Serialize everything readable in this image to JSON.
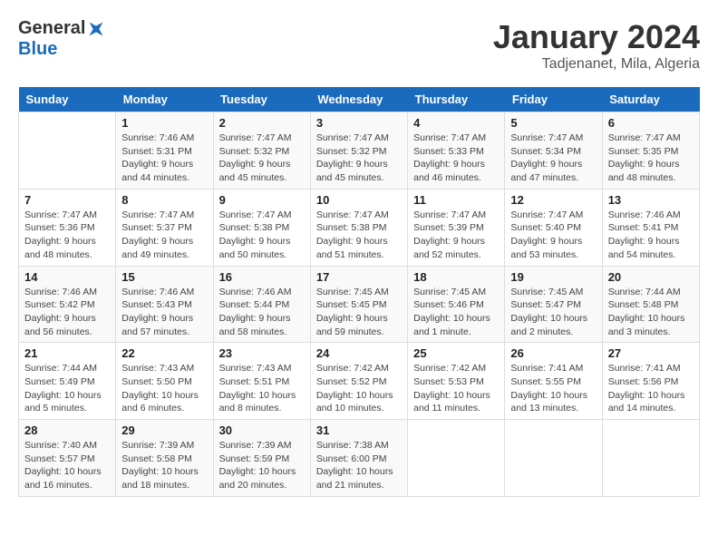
{
  "header": {
    "logo_general": "General",
    "logo_blue": "Blue",
    "month_title": "January 2024",
    "subtitle": "Tadjenanet, Mila, Algeria"
  },
  "days_of_week": [
    "Sunday",
    "Monday",
    "Tuesday",
    "Wednesday",
    "Thursday",
    "Friday",
    "Saturday"
  ],
  "weeks": [
    [
      {
        "day": "",
        "sunrise": "",
        "sunset": "",
        "daylight": ""
      },
      {
        "day": "1",
        "sunrise": "Sunrise: 7:46 AM",
        "sunset": "Sunset: 5:31 PM",
        "daylight": "Daylight: 9 hours and 44 minutes."
      },
      {
        "day": "2",
        "sunrise": "Sunrise: 7:47 AM",
        "sunset": "Sunset: 5:32 PM",
        "daylight": "Daylight: 9 hours and 45 minutes."
      },
      {
        "day": "3",
        "sunrise": "Sunrise: 7:47 AM",
        "sunset": "Sunset: 5:32 PM",
        "daylight": "Daylight: 9 hours and 45 minutes."
      },
      {
        "day": "4",
        "sunrise": "Sunrise: 7:47 AM",
        "sunset": "Sunset: 5:33 PM",
        "daylight": "Daylight: 9 hours and 46 minutes."
      },
      {
        "day": "5",
        "sunrise": "Sunrise: 7:47 AM",
        "sunset": "Sunset: 5:34 PM",
        "daylight": "Daylight: 9 hours and 47 minutes."
      },
      {
        "day": "6",
        "sunrise": "Sunrise: 7:47 AM",
        "sunset": "Sunset: 5:35 PM",
        "daylight": "Daylight: 9 hours and 48 minutes."
      }
    ],
    [
      {
        "day": "7",
        "sunrise": "Sunrise: 7:47 AM",
        "sunset": "Sunset: 5:36 PM",
        "daylight": "Daylight: 9 hours and 48 minutes."
      },
      {
        "day": "8",
        "sunrise": "Sunrise: 7:47 AM",
        "sunset": "Sunset: 5:37 PM",
        "daylight": "Daylight: 9 hours and 49 minutes."
      },
      {
        "day": "9",
        "sunrise": "Sunrise: 7:47 AM",
        "sunset": "Sunset: 5:38 PM",
        "daylight": "Daylight: 9 hours and 50 minutes."
      },
      {
        "day": "10",
        "sunrise": "Sunrise: 7:47 AM",
        "sunset": "Sunset: 5:38 PM",
        "daylight": "Daylight: 9 hours and 51 minutes."
      },
      {
        "day": "11",
        "sunrise": "Sunrise: 7:47 AM",
        "sunset": "Sunset: 5:39 PM",
        "daylight": "Daylight: 9 hours and 52 minutes."
      },
      {
        "day": "12",
        "sunrise": "Sunrise: 7:47 AM",
        "sunset": "Sunset: 5:40 PM",
        "daylight": "Daylight: 9 hours and 53 minutes."
      },
      {
        "day": "13",
        "sunrise": "Sunrise: 7:46 AM",
        "sunset": "Sunset: 5:41 PM",
        "daylight": "Daylight: 9 hours and 54 minutes."
      }
    ],
    [
      {
        "day": "14",
        "sunrise": "Sunrise: 7:46 AM",
        "sunset": "Sunset: 5:42 PM",
        "daylight": "Daylight: 9 hours and 56 minutes."
      },
      {
        "day": "15",
        "sunrise": "Sunrise: 7:46 AM",
        "sunset": "Sunset: 5:43 PM",
        "daylight": "Daylight: 9 hours and 57 minutes."
      },
      {
        "day": "16",
        "sunrise": "Sunrise: 7:46 AM",
        "sunset": "Sunset: 5:44 PM",
        "daylight": "Daylight: 9 hours and 58 minutes."
      },
      {
        "day": "17",
        "sunrise": "Sunrise: 7:45 AM",
        "sunset": "Sunset: 5:45 PM",
        "daylight": "Daylight: 9 hours and 59 minutes."
      },
      {
        "day": "18",
        "sunrise": "Sunrise: 7:45 AM",
        "sunset": "Sunset: 5:46 PM",
        "daylight": "Daylight: 10 hours and 1 minute."
      },
      {
        "day": "19",
        "sunrise": "Sunrise: 7:45 AM",
        "sunset": "Sunset: 5:47 PM",
        "daylight": "Daylight: 10 hours and 2 minutes."
      },
      {
        "day": "20",
        "sunrise": "Sunrise: 7:44 AM",
        "sunset": "Sunset: 5:48 PM",
        "daylight": "Daylight: 10 hours and 3 minutes."
      }
    ],
    [
      {
        "day": "21",
        "sunrise": "Sunrise: 7:44 AM",
        "sunset": "Sunset: 5:49 PM",
        "daylight": "Daylight: 10 hours and 5 minutes."
      },
      {
        "day": "22",
        "sunrise": "Sunrise: 7:43 AM",
        "sunset": "Sunset: 5:50 PM",
        "daylight": "Daylight: 10 hours and 6 minutes."
      },
      {
        "day": "23",
        "sunrise": "Sunrise: 7:43 AM",
        "sunset": "Sunset: 5:51 PM",
        "daylight": "Daylight: 10 hours and 8 minutes."
      },
      {
        "day": "24",
        "sunrise": "Sunrise: 7:42 AM",
        "sunset": "Sunset: 5:52 PM",
        "daylight": "Daylight: 10 hours and 10 minutes."
      },
      {
        "day": "25",
        "sunrise": "Sunrise: 7:42 AM",
        "sunset": "Sunset: 5:53 PM",
        "daylight": "Daylight: 10 hours and 11 minutes."
      },
      {
        "day": "26",
        "sunrise": "Sunrise: 7:41 AM",
        "sunset": "Sunset: 5:55 PM",
        "daylight": "Daylight: 10 hours and 13 minutes."
      },
      {
        "day": "27",
        "sunrise": "Sunrise: 7:41 AM",
        "sunset": "Sunset: 5:56 PM",
        "daylight": "Daylight: 10 hours and 14 minutes."
      }
    ],
    [
      {
        "day": "28",
        "sunrise": "Sunrise: 7:40 AM",
        "sunset": "Sunset: 5:57 PM",
        "daylight": "Daylight: 10 hours and 16 minutes."
      },
      {
        "day": "29",
        "sunrise": "Sunrise: 7:39 AM",
        "sunset": "Sunset: 5:58 PM",
        "daylight": "Daylight: 10 hours and 18 minutes."
      },
      {
        "day": "30",
        "sunrise": "Sunrise: 7:39 AM",
        "sunset": "Sunset: 5:59 PM",
        "daylight": "Daylight: 10 hours and 20 minutes."
      },
      {
        "day": "31",
        "sunrise": "Sunrise: 7:38 AM",
        "sunset": "Sunset: 6:00 PM",
        "daylight": "Daylight: 10 hours and 21 minutes."
      },
      {
        "day": "",
        "sunrise": "",
        "sunset": "",
        "daylight": ""
      },
      {
        "day": "",
        "sunrise": "",
        "sunset": "",
        "daylight": ""
      },
      {
        "day": "",
        "sunrise": "",
        "sunset": "",
        "daylight": ""
      }
    ]
  ]
}
